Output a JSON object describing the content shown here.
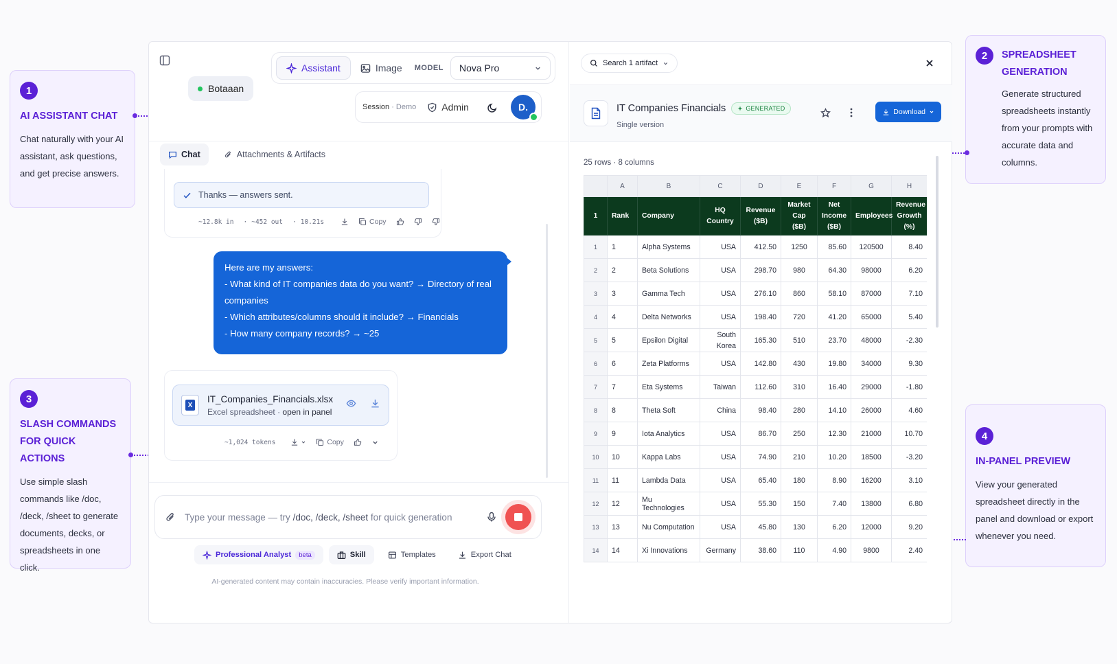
{
  "callouts": [
    {
      "num": "1",
      "title": "AI ASSISTANT CHAT",
      "body": "Chat naturally with your AI assistant, ask questions, and get precise answers."
    },
    {
      "num": "2",
      "title": "SPREADSHEET GENERATION",
      "body": "Generate structured spreadsheets instantly from your prompts with accurate data and columns."
    },
    {
      "num": "3",
      "title": "SLASH COMMANDS FOR QUICK ACTIONS",
      "body": "Use simple slash commands like /doc, /deck, /sheet to generate documents, decks, or spreadsheets in one click."
    },
    {
      "num": "4",
      "title": "IN-PANEL PREVIEW",
      "body": "View your generated spreadsheet directly in the panel and download or export whenever you need."
    }
  ],
  "topbar": {
    "assistant": "Assistant",
    "image": "Image",
    "model_label": "MODEL",
    "model_value": "Nova Pro"
  },
  "bot": {
    "name": "Botaaan"
  },
  "session": {
    "label": "Session",
    "sep": " · ",
    "mode": "Demo",
    "admin": "Admin",
    "avatar": "D."
  },
  "tabs": {
    "chat": "Chat",
    "attachments": "Attachments & Artifacts"
  },
  "thanks": {
    "text": "Thanks — answers sent."
  },
  "meta1": {
    "tokens_in": "~12.8k in",
    "tokens_out": "~452 out",
    "time": "10.21s",
    "copy": "Copy"
  },
  "user_message": {
    "lines": [
      "Here are my answers:",
      "- What kind of IT companies data do you want? → Directory of real",
      "companies",
      "- Which attributes/columns should it include? → Financials",
      "- How many company records? → ~25"
    ]
  },
  "file": {
    "name": "IT_Companies_Financials.xlsx",
    "type": "Excel spreadsheet",
    "sep": " · ",
    "action": "open in panel"
  },
  "meta2": {
    "tokens": "~1,024 tokens",
    "copy": "Copy"
  },
  "composer": {
    "placeholder_a": "Type your message — try ",
    "placeholder_b": "/doc, /deck, /sheet",
    "placeholder_c": " for quick generation"
  },
  "tools": {
    "analyst": "Professional Analyst",
    "beta": "beta",
    "skill": "Skill",
    "templates": "Templates",
    "export": "Export Chat"
  },
  "disclaimer": "AI-generated content may contain inaccuracies. Please verify important information.",
  "artifact": {
    "search": "Search 1 artifact",
    "title": "IT Companies Financials",
    "badge": "GENERATED",
    "subtitle": "Single version",
    "download": "Download",
    "rowcount": "25 rows · 8 columns"
  },
  "sheet": {
    "col_letters": [
      "A",
      "B",
      "C",
      "D",
      "E",
      "F",
      "G",
      "H"
    ],
    "header_row_num": "1",
    "headers": [
      "Rank",
      "Company",
      "HQ Country",
      "Revenue ($B)",
      "Market Cap ($B)",
      "Net Income ($B)",
      "Employees",
      "Revenue Growth (%)"
    ],
    "rows": [
      [
        "1",
        "Alpha Systems",
        "USA",
        "412.50",
        "1250",
        "85.60",
        "120500",
        "8.40"
      ],
      [
        "2",
        "Beta Solutions",
        "USA",
        "298.70",
        "980",
        "64.30",
        "98000",
        "6.20"
      ],
      [
        "3",
        "Gamma Tech",
        "USA",
        "276.10",
        "860",
        "58.10",
        "87000",
        "7.10"
      ],
      [
        "4",
        "Delta Networks",
        "USA",
        "198.40",
        "720",
        "41.20",
        "65000",
        "5.40"
      ],
      [
        "5",
        "Epsilon Digital",
        "South Korea",
        "165.30",
        "510",
        "23.70",
        "48000",
        "-2.30"
      ],
      [
        "6",
        "Zeta Platforms",
        "USA",
        "142.80",
        "430",
        "19.80",
        "34000",
        "9.30"
      ],
      [
        "7",
        "Eta Systems",
        "Taiwan",
        "112.60",
        "310",
        "16.40",
        "29000",
        "-1.80"
      ],
      [
        "8",
        "Theta Soft",
        "China",
        "98.40",
        "280",
        "14.10",
        "26000",
        "4.60"
      ],
      [
        "9",
        "Iota Analytics",
        "USA",
        "86.70",
        "250",
        "12.30",
        "21000",
        "10.70"
      ],
      [
        "10",
        "Kappa Labs",
        "USA",
        "74.90",
        "210",
        "10.20",
        "18500",
        "-3.20"
      ],
      [
        "11",
        "Lambda Data",
        "USA",
        "65.40",
        "180",
        "8.90",
        "16200",
        "3.10"
      ],
      [
        "12",
        "Mu Technologies",
        "USA",
        "55.30",
        "150",
        "7.40",
        "13800",
        "6.80"
      ],
      [
        "13",
        "Nu Computation",
        "USA",
        "45.80",
        "130",
        "6.20",
        "12000",
        "9.20"
      ],
      [
        "14",
        "Xi Innovations",
        "Germany",
        "38.60",
        "110",
        "4.90",
        "9800",
        "2.40"
      ]
    ],
    "row_nums": [
      "1",
      "2",
      "3",
      "4",
      "5",
      "6",
      "7",
      "8",
      "9",
      "10",
      "11",
      "12",
      "13",
      "14"
    ]
  },
  "colors": {
    "accent": "#5b21d6",
    "primary": "#1565d8",
    "header_bg": "#0c3a1e",
    "stop": "#f05252"
  }
}
